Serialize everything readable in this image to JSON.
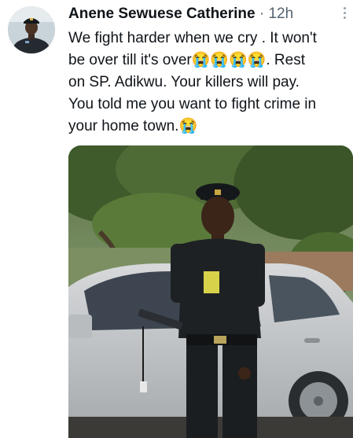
{
  "tweet": {
    "author": "Anene Sewuese Catherine",
    "separator": "·",
    "time": "12h",
    "text_lines": [
      "We fight harder when we cry . It won't",
      "be over till it's over😭😭😭😭.  Rest",
      "on SP. Adikwu. Your killers will pay.",
      "You told me you want to fight crime in",
      "your home town.😭"
    ]
  },
  "icons": {
    "more": "more-vertical-icon"
  },
  "colors": {
    "name": "#0f1419",
    "meta": "#536471",
    "background": "#ffffff"
  }
}
